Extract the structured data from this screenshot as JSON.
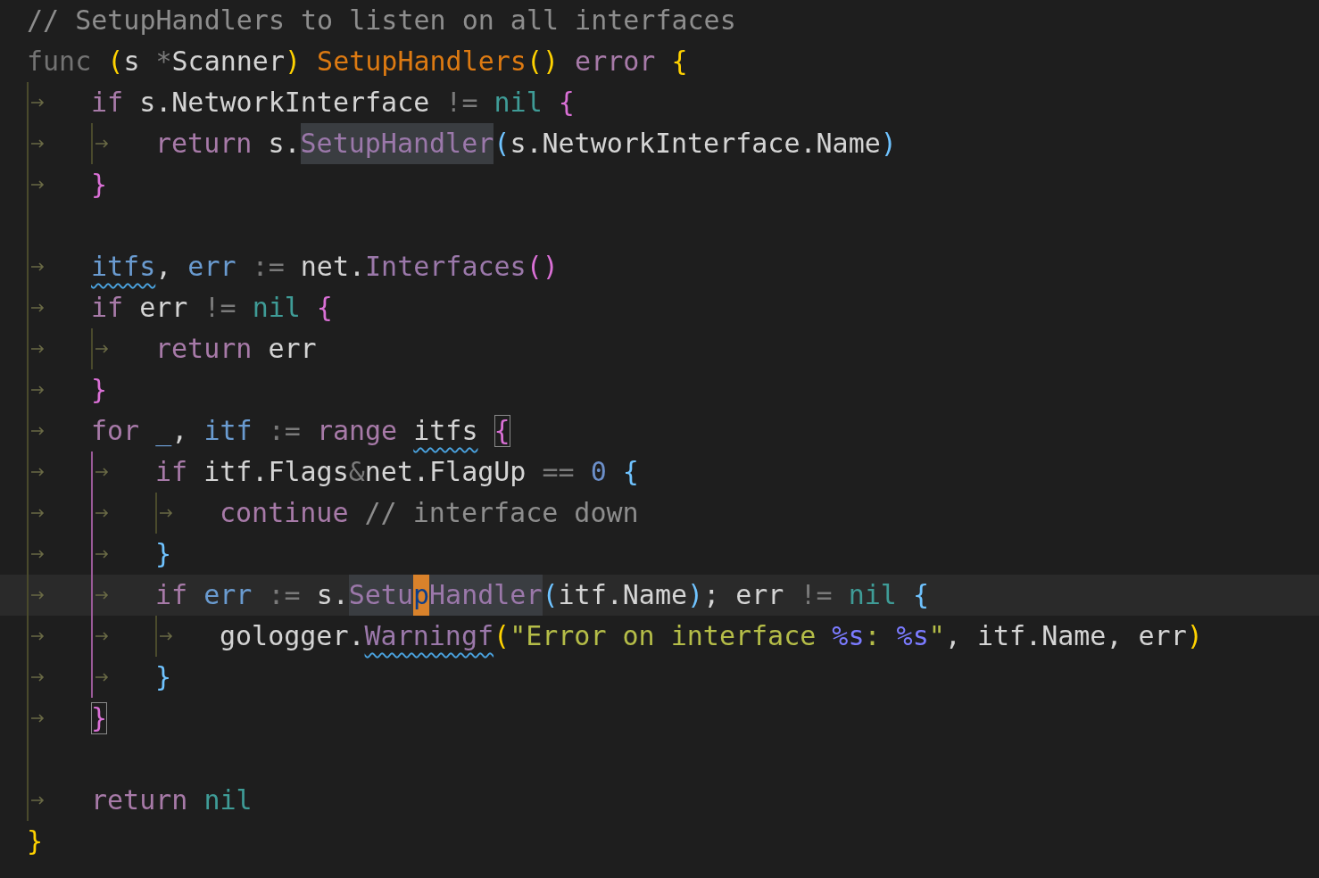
{
  "lines": [
    {
      "current": false,
      "tokens": [
        {
          "text": "// SetupHandlers to listen on all interfaces",
          "kind": "comment"
        }
      ]
    },
    {
      "current": false,
      "tokens": [
        {
          "text": "func ",
          "kind": "func"
        },
        {
          "text": "(",
          "kind": "p1"
        },
        {
          "text": "s ",
          "kind": "plain"
        },
        {
          "text": "*",
          "kind": "op"
        },
        {
          "text": "Scanner",
          "kind": "plain"
        },
        {
          "text": ")",
          "kind": "p1"
        },
        {
          "text": " SetupHandlers",
          "kind": "fn"
        },
        {
          "text": "()",
          "kind": "p1"
        },
        {
          "text": " error",
          "kind": "kw"
        },
        {
          "text": " {",
          "kind": "p1"
        }
      ]
    },
    {
      "current": false,
      "tokens": [
        {
          "kind": "tab"
        },
        {
          "text": "if",
          "kind": "kw"
        },
        {
          "text": " s.NetworkInterface",
          "kind": "plain"
        },
        {
          "text": " != ",
          "kind": "op"
        },
        {
          "text": "nil",
          "kind": "const"
        },
        {
          "text": " {",
          "kind": "p2"
        }
      ]
    },
    {
      "current": false,
      "tokens": [
        {
          "kind": "tab"
        },
        {
          "kind": "tab"
        },
        {
          "text": "return",
          "kind": "kw"
        },
        {
          "text": " s.",
          "kind": "plain"
        },
        {
          "text": "SetupHandler",
          "kind": "method",
          "highlighted": true
        },
        {
          "text": "(",
          "kind": "p3"
        },
        {
          "text": "s.NetworkInterface.Name",
          "kind": "plain"
        },
        {
          "text": ")",
          "kind": "p3"
        }
      ]
    },
    {
      "current": false,
      "tokens": [
        {
          "kind": "tab"
        },
        {
          "text": "}",
          "kind": "p2"
        }
      ]
    },
    {
      "current": false,
      "tokens": [
        {
          "kind": "guide"
        }
      ]
    },
    {
      "current": false,
      "tokens": [
        {
          "kind": "tab"
        },
        {
          "text": "itfs",
          "kind": "var",
          "squiggly": true
        },
        {
          "text": ",",
          "kind": "plain"
        },
        {
          "text": " err",
          "kind": "var"
        },
        {
          "text": " := ",
          "kind": "op"
        },
        {
          "text": "net.",
          "kind": "plain"
        },
        {
          "text": "Interfaces",
          "kind": "method"
        },
        {
          "text": "()",
          "kind": "p2"
        }
      ]
    },
    {
      "current": false,
      "tokens": [
        {
          "kind": "tab"
        },
        {
          "text": "if",
          "kind": "kw"
        },
        {
          "text": " err",
          "kind": "plain"
        },
        {
          "text": " != ",
          "kind": "op"
        },
        {
          "text": "nil",
          "kind": "const"
        },
        {
          "text": " {",
          "kind": "p2"
        }
      ]
    },
    {
      "current": false,
      "tokens": [
        {
          "kind": "tab"
        },
        {
          "kind": "tab"
        },
        {
          "text": "return",
          "kind": "kw"
        },
        {
          "text": " err",
          "kind": "plain"
        }
      ]
    },
    {
      "current": false,
      "tokens": [
        {
          "kind": "tab"
        },
        {
          "text": "}",
          "kind": "p2"
        }
      ]
    },
    {
      "current": false,
      "tokens": [
        {
          "kind": "tab"
        },
        {
          "text": "for",
          "kind": "kw"
        },
        {
          "text": " _",
          "kind": "var"
        },
        {
          "text": ",",
          "kind": "plain"
        },
        {
          "text": " itf",
          "kind": "var"
        },
        {
          "text": " := ",
          "kind": "op"
        },
        {
          "text": "range ",
          "kind": "kw"
        },
        {
          "text": "itfs",
          "kind": "plain",
          "squiggly": true
        },
        {
          "text": " {",
          "kind": "p2",
          "bracket_match": true
        }
      ]
    },
    {
      "current": false,
      "tokens": [
        {
          "kind": "tab"
        },
        {
          "kind": "tab",
          "in_scope": true
        },
        {
          "text": "if",
          "kind": "kw"
        },
        {
          "text": " itf.Flags",
          "kind": "plain"
        },
        {
          "text": "&",
          "kind": "op"
        },
        {
          "text": "net.FlagUp",
          "kind": "plain"
        },
        {
          "text": " == ",
          "kind": "op"
        },
        {
          "text": "0",
          "kind": "num"
        },
        {
          "text": " {",
          "kind": "p3"
        }
      ]
    },
    {
      "current": false,
      "tokens": [
        {
          "kind": "tab"
        },
        {
          "kind": "tab",
          "in_scope": true
        },
        {
          "kind": "tab"
        },
        {
          "text": "continue",
          "kind": "kw"
        },
        {
          "text": " // interface down",
          "kind": "comment"
        }
      ]
    },
    {
      "current": false,
      "tokens": [
        {
          "kind": "tab"
        },
        {
          "kind": "tab",
          "in_scope": true
        },
        {
          "text": "}",
          "kind": "p3"
        }
      ]
    },
    {
      "current": true,
      "tokens": [
        {
          "kind": "tab"
        },
        {
          "kind": "tab",
          "in_scope": true
        },
        {
          "text": "if",
          "kind": "kw"
        },
        {
          "text": " err",
          "kind": "var"
        },
        {
          "text": " := ",
          "kind": "op"
        },
        {
          "text": "s.",
          "kind": "plain"
        },
        {
          "text": "Setu",
          "kind": "method",
          "highlighted": true
        },
        {
          "text": "p",
          "kind": "method",
          "cursor": true
        },
        {
          "text": "Handler",
          "kind": "method",
          "highlighted": true
        },
        {
          "text": "(",
          "kind": "p3"
        },
        {
          "text": "itf.Name",
          "kind": "plain"
        },
        {
          "text": ")",
          "kind": "p3"
        },
        {
          "text": "; err",
          "kind": "plain"
        },
        {
          "text": " != ",
          "kind": "op"
        },
        {
          "text": "nil",
          "kind": "const"
        },
        {
          "text": " {",
          "kind": "p3"
        }
      ]
    },
    {
      "current": false,
      "tokens": [
        {
          "kind": "tab"
        },
        {
          "kind": "tab",
          "in_scope": true
        },
        {
          "kind": "tab"
        },
        {
          "text": "gologger.",
          "kind": "plain"
        },
        {
          "text": "Warningf",
          "kind": "method",
          "squiggly": true
        },
        {
          "text": "(",
          "kind": "p1"
        },
        {
          "text": "\"Error on interface ",
          "kind": "str"
        },
        {
          "text": "%s",
          "kind": "fmt"
        },
        {
          "text": ": ",
          "kind": "str"
        },
        {
          "text": "%s",
          "kind": "fmt"
        },
        {
          "text": "\"",
          "kind": "str"
        },
        {
          "text": ", itf.Name, err",
          "kind": "plain"
        },
        {
          "text": ")",
          "kind": "p1"
        }
      ]
    },
    {
      "current": false,
      "tokens": [
        {
          "kind": "tab"
        },
        {
          "kind": "tab",
          "in_scope": true
        },
        {
          "text": "}",
          "kind": "p3"
        }
      ]
    },
    {
      "current": false,
      "tokens": [
        {
          "kind": "tab"
        },
        {
          "text": "}",
          "kind": "p2",
          "bracket_match": true
        }
      ]
    },
    {
      "current": false,
      "tokens": [
        {
          "kind": "guide"
        }
      ]
    },
    {
      "current": false,
      "tokens": [
        {
          "kind": "tab"
        },
        {
          "text": "return",
          "kind": "kw"
        },
        {
          "text": " nil",
          "kind": "const"
        }
      ]
    },
    {
      "current": false,
      "tokens": [
        {
          "text": "}",
          "kind": "p1"
        }
      ]
    }
  ]
}
